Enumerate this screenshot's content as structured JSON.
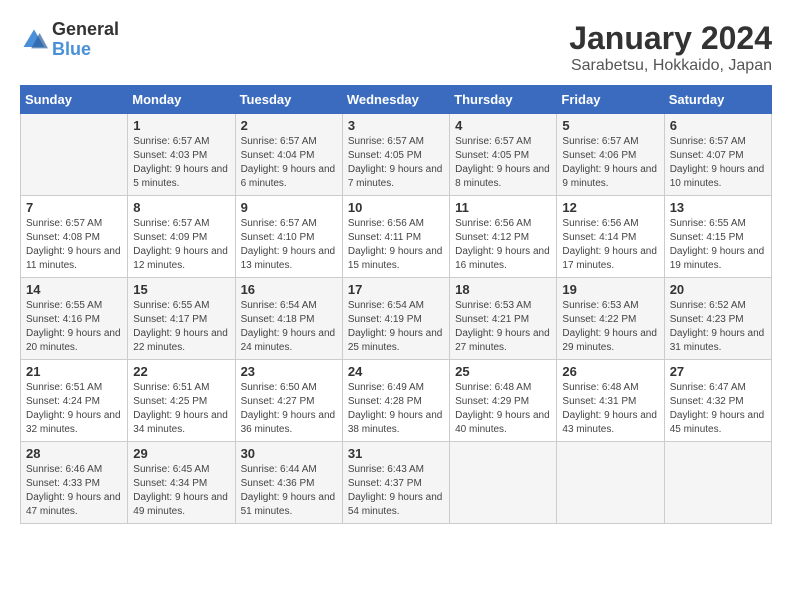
{
  "logo": {
    "text_general": "General",
    "text_blue": "Blue"
  },
  "title": "January 2024",
  "subtitle": "Sarabetsu, Hokkaido, Japan",
  "days_of_week": [
    "Sunday",
    "Monday",
    "Tuesday",
    "Wednesday",
    "Thursday",
    "Friday",
    "Saturday"
  ],
  "weeks": [
    [
      {
        "day": "",
        "sunrise": "",
        "sunset": "",
        "daylight": ""
      },
      {
        "day": "1",
        "sunrise": "Sunrise: 6:57 AM",
        "sunset": "Sunset: 4:03 PM",
        "daylight": "Daylight: 9 hours and 5 minutes."
      },
      {
        "day": "2",
        "sunrise": "Sunrise: 6:57 AM",
        "sunset": "Sunset: 4:04 PM",
        "daylight": "Daylight: 9 hours and 6 minutes."
      },
      {
        "day": "3",
        "sunrise": "Sunrise: 6:57 AM",
        "sunset": "Sunset: 4:05 PM",
        "daylight": "Daylight: 9 hours and 7 minutes."
      },
      {
        "day": "4",
        "sunrise": "Sunrise: 6:57 AM",
        "sunset": "Sunset: 4:05 PM",
        "daylight": "Daylight: 9 hours and 8 minutes."
      },
      {
        "day": "5",
        "sunrise": "Sunrise: 6:57 AM",
        "sunset": "Sunset: 4:06 PM",
        "daylight": "Daylight: 9 hours and 9 minutes."
      },
      {
        "day": "6",
        "sunrise": "Sunrise: 6:57 AM",
        "sunset": "Sunset: 4:07 PM",
        "daylight": "Daylight: 9 hours and 10 minutes."
      }
    ],
    [
      {
        "day": "7",
        "sunrise": "Sunrise: 6:57 AM",
        "sunset": "Sunset: 4:08 PM",
        "daylight": "Daylight: 9 hours and 11 minutes."
      },
      {
        "day": "8",
        "sunrise": "Sunrise: 6:57 AM",
        "sunset": "Sunset: 4:09 PM",
        "daylight": "Daylight: 9 hours and 12 minutes."
      },
      {
        "day": "9",
        "sunrise": "Sunrise: 6:57 AM",
        "sunset": "Sunset: 4:10 PM",
        "daylight": "Daylight: 9 hours and 13 minutes."
      },
      {
        "day": "10",
        "sunrise": "Sunrise: 6:56 AM",
        "sunset": "Sunset: 4:11 PM",
        "daylight": "Daylight: 9 hours and 15 minutes."
      },
      {
        "day": "11",
        "sunrise": "Sunrise: 6:56 AM",
        "sunset": "Sunset: 4:12 PM",
        "daylight": "Daylight: 9 hours and 16 minutes."
      },
      {
        "day": "12",
        "sunrise": "Sunrise: 6:56 AM",
        "sunset": "Sunset: 4:14 PM",
        "daylight": "Daylight: 9 hours and 17 minutes."
      },
      {
        "day": "13",
        "sunrise": "Sunrise: 6:55 AM",
        "sunset": "Sunset: 4:15 PM",
        "daylight": "Daylight: 9 hours and 19 minutes."
      }
    ],
    [
      {
        "day": "14",
        "sunrise": "Sunrise: 6:55 AM",
        "sunset": "Sunset: 4:16 PM",
        "daylight": "Daylight: 9 hours and 20 minutes."
      },
      {
        "day": "15",
        "sunrise": "Sunrise: 6:55 AM",
        "sunset": "Sunset: 4:17 PM",
        "daylight": "Daylight: 9 hours and 22 minutes."
      },
      {
        "day": "16",
        "sunrise": "Sunrise: 6:54 AM",
        "sunset": "Sunset: 4:18 PM",
        "daylight": "Daylight: 9 hours and 24 minutes."
      },
      {
        "day": "17",
        "sunrise": "Sunrise: 6:54 AM",
        "sunset": "Sunset: 4:19 PM",
        "daylight": "Daylight: 9 hours and 25 minutes."
      },
      {
        "day": "18",
        "sunrise": "Sunrise: 6:53 AM",
        "sunset": "Sunset: 4:21 PM",
        "daylight": "Daylight: 9 hours and 27 minutes."
      },
      {
        "day": "19",
        "sunrise": "Sunrise: 6:53 AM",
        "sunset": "Sunset: 4:22 PM",
        "daylight": "Daylight: 9 hours and 29 minutes."
      },
      {
        "day": "20",
        "sunrise": "Sunrise: 6:52 AM",
        "sunset": "Sunset: 4:23 PM",
        "daylight": "Daylight: 9 hours and 31 minutes."
      }
    ],
    [
      {
        "day": "21",
        "sunrise": "Sunrise: 6:51 AM",
        "sunset": "Sunset: 4:24 PM",
        "daylight": "Daylight: 9 hours and 32 minutes."
      },
      {
        "day": "22",
        "sunrise": "Sunrise: 6:51 AM",
        "sunset": "Sunset: 4:25 PM",
        "daylight": "Daylight: 9 hours and 34 minutes."
      },
      {
        "day": "23",
        "sunrise": "Sunrise: 6:50 AM",
        "sunset": "Sunset: 4:27 PM",
        "daylight": "Daylight: 9 hours and 36 minutes."
      },
      {
        "day": "24",
        "sunrise": "Sunrise: 6:49 AM",
        "sunset": "Sunset: 4:28 PM",
        "daylight": "Daylight: 9 hours and 38 minutes."
      },
      {
        "day": "25",
        "sunrise": "Sunrise: 6:48 AM",
        "sunset": "Sunset: 4:29 PM",
        "daylight": "Daylight: 9 hours and 40 minutes."
      },
      {
        "day": "26",
        "sunrise": "Sunrise: 6:48 AM",
        "sunset": "Sunset: 4:31 PM",
        "daylight": "Daylight: 9 hours and 43 minutes."
      },
      {
        "day": "27",
        "sunrise": "Sunrise: 6:47 AM",
        "sunset": "Sunset: 4:32 PM",
        "daylight": "Daylight: 9 hours and 45 minutes."
      }
    ],
    [
      {
        "day": "28",
        "sunrise": "Sunrise: 6:46 AM",
        "sunset": "Sunset: 4:33 PM",
        "daylight": "Daylight: 9 hours and 47 minutes."
      },
      {
        "day": "29",
        "sunrise": "Sunrise: 6:45 AM",
        "sunset": "Sunset: 4:34 PM",
        "daylight": "Daylight: 9 hours and 49 minutes."
      },
      {
        "day": "30",
        "sunrise": "Sunrise: 6:44 AM",
        "sunset": "Sunset: 4:36 PM",
        "daylight": "Daylight: 9 hours and 51 minutes."
      },
      {
        "day": "31",
        "sunrise": "Sunrise: 6:43 AM",
        "sunset": "Sunset: 4:37 PM",
        "daylight": "Daylight: 9 hours and 54 minutes."
      },
      {
        "day": "",
        "sunrise": "",
        "sunset": "",
        "daylight": ""
      },
      {
        "day": "",
        "sunrise": "",
        "sunset": "",
        "daylight": ""
      },
      {
        "day": "",
        "sunrise": "",
        "sunset": "",
        "daylight": ""
      }
    ]
  ]
}
